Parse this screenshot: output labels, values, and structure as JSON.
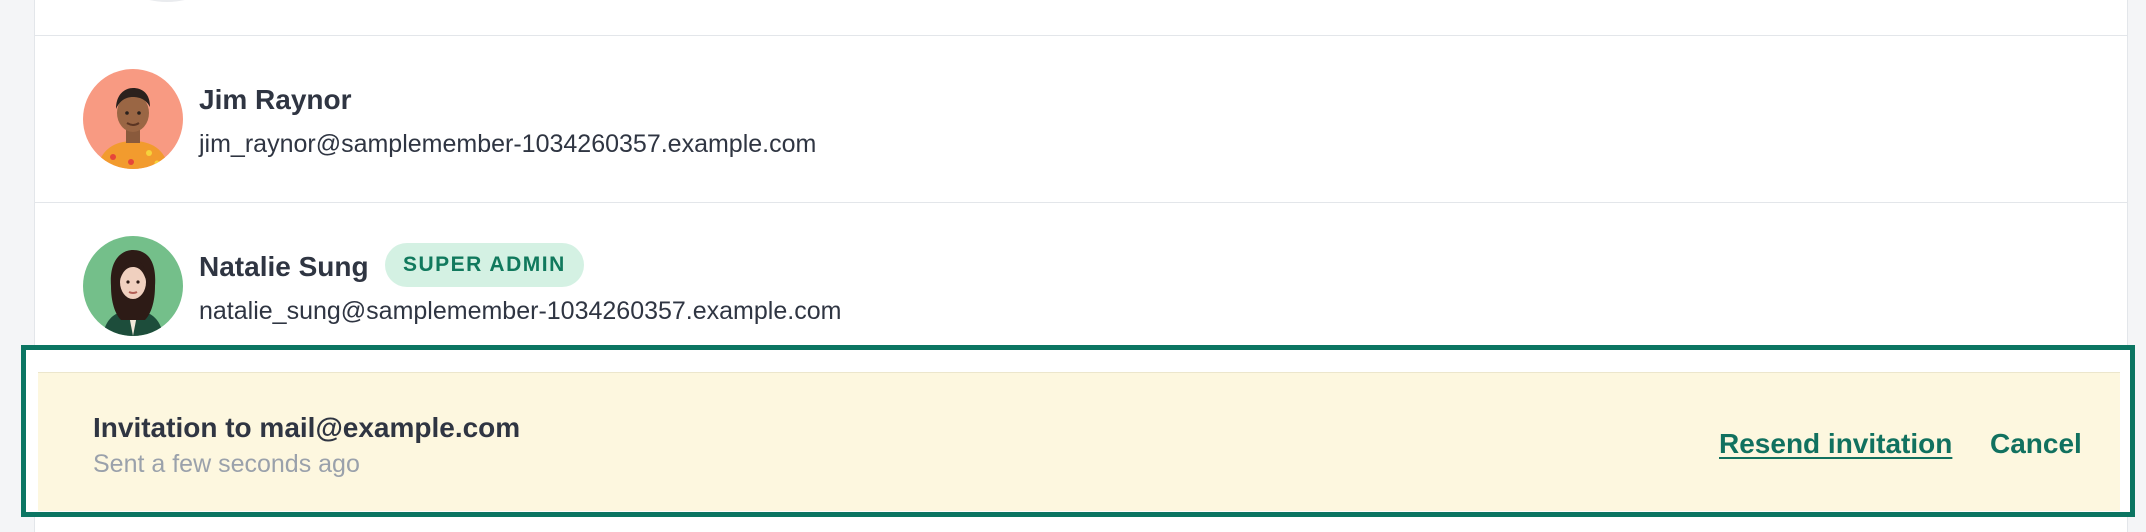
{
  "members": [
    {
      "name": "Jim Raynor",
      "email": "jim_raynor@samplemember-1034260357.example.com",
      "avatar_icon": "man-portrait-avatar",
      "avatar_bg": "#f89a82"
    },
    {
      "name": "Natalie Sung",
      "badge": "SUPER ADMIN",
      "email": "natalie_sung@samplemember-1034260357.example.com",
      "avatar_icon": "woman-portrait-avatar",
      "avatar_bg": "#74bf8a"
    }
  ],
  "invitation": {
    "title": "Invitation to mail@example.com",
    "sent": "Sent a few seconds ago",
    "resend_label": "Resend invitation",
    "cancel_label": "Cancel"
  },
  "colors": {
    "accent": "#11715f",
    "highlight_border": "#0b7562",
    "invite_bg": "#fdf7df",
    "badge_bg": "#d4f1e3",
    "badge_text": "#11795d"
  }
}
